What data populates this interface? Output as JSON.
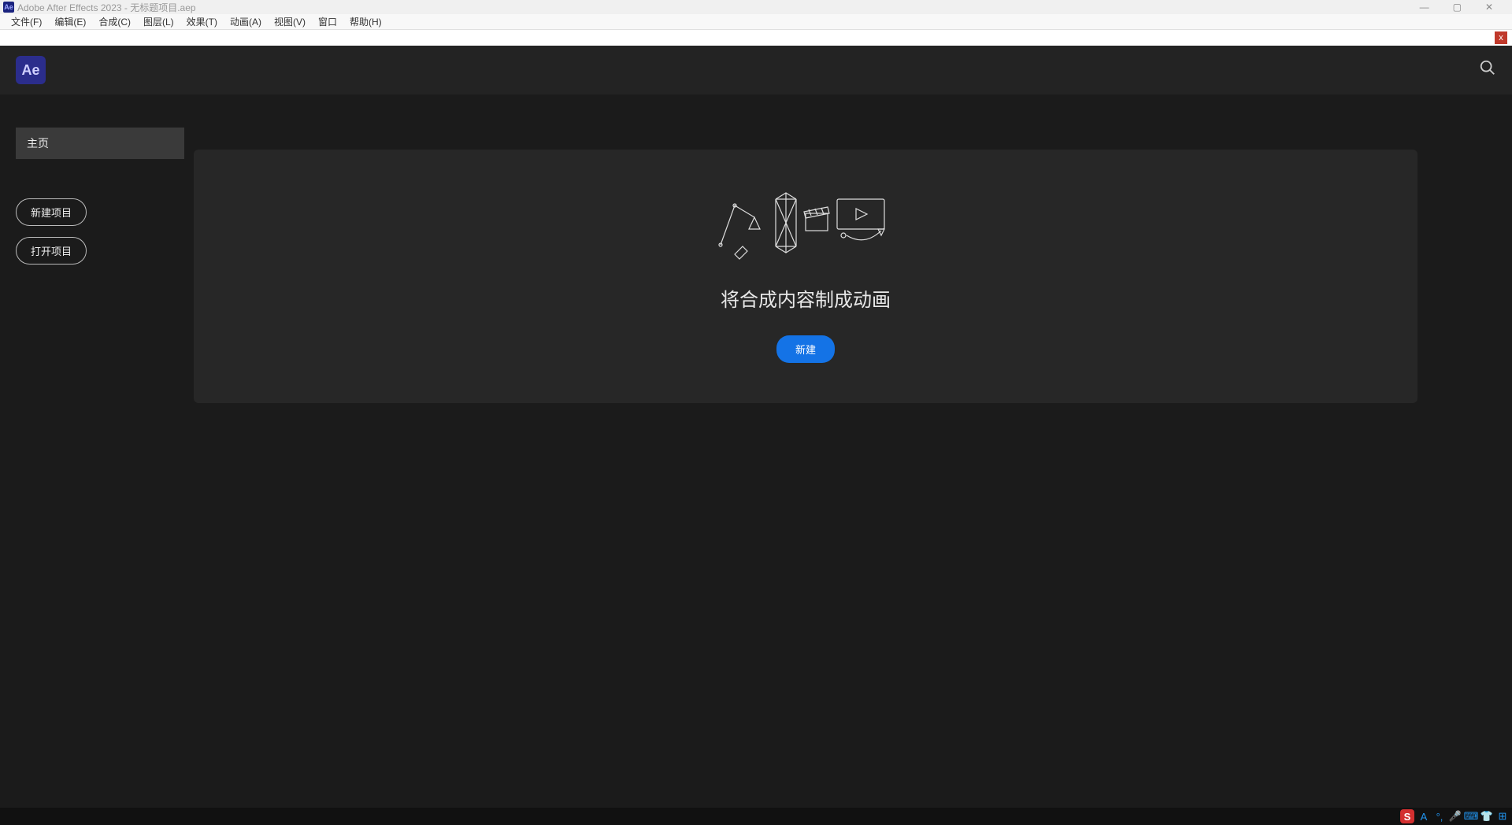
{
  "window": {
    "title": "Adobe After Effects 2023 - 无标题项目.aep",
    "app_short": "Ae"
  },
  "menubar": {
    "items": [
      "文件(F)",
      "编辑(E)",
      "合成(C)",
      "图层(L)",
      "效果(T)",
      "动画(A)",
      "视图(V)",
      "窗口",
      "帮助(H)"
    ]
  },
  "app_header": {
    "logo_text": "Ae"
  },
  "sidebar": {
    "home_label": "主页",
    "new_project_label": "新建项目",
    "open_project_label": "打开项目"
  },
  "card": {
    "heading": "将合成内容制成动画",
    "new_button": "新建"
  },
  "colors": {
    "accent": "#1473e6",
    "logo_bg": "#2b2d8c",
    "dark_bg": "#1b1b1b",
    "panel_bg": "#272727"
  }
}
